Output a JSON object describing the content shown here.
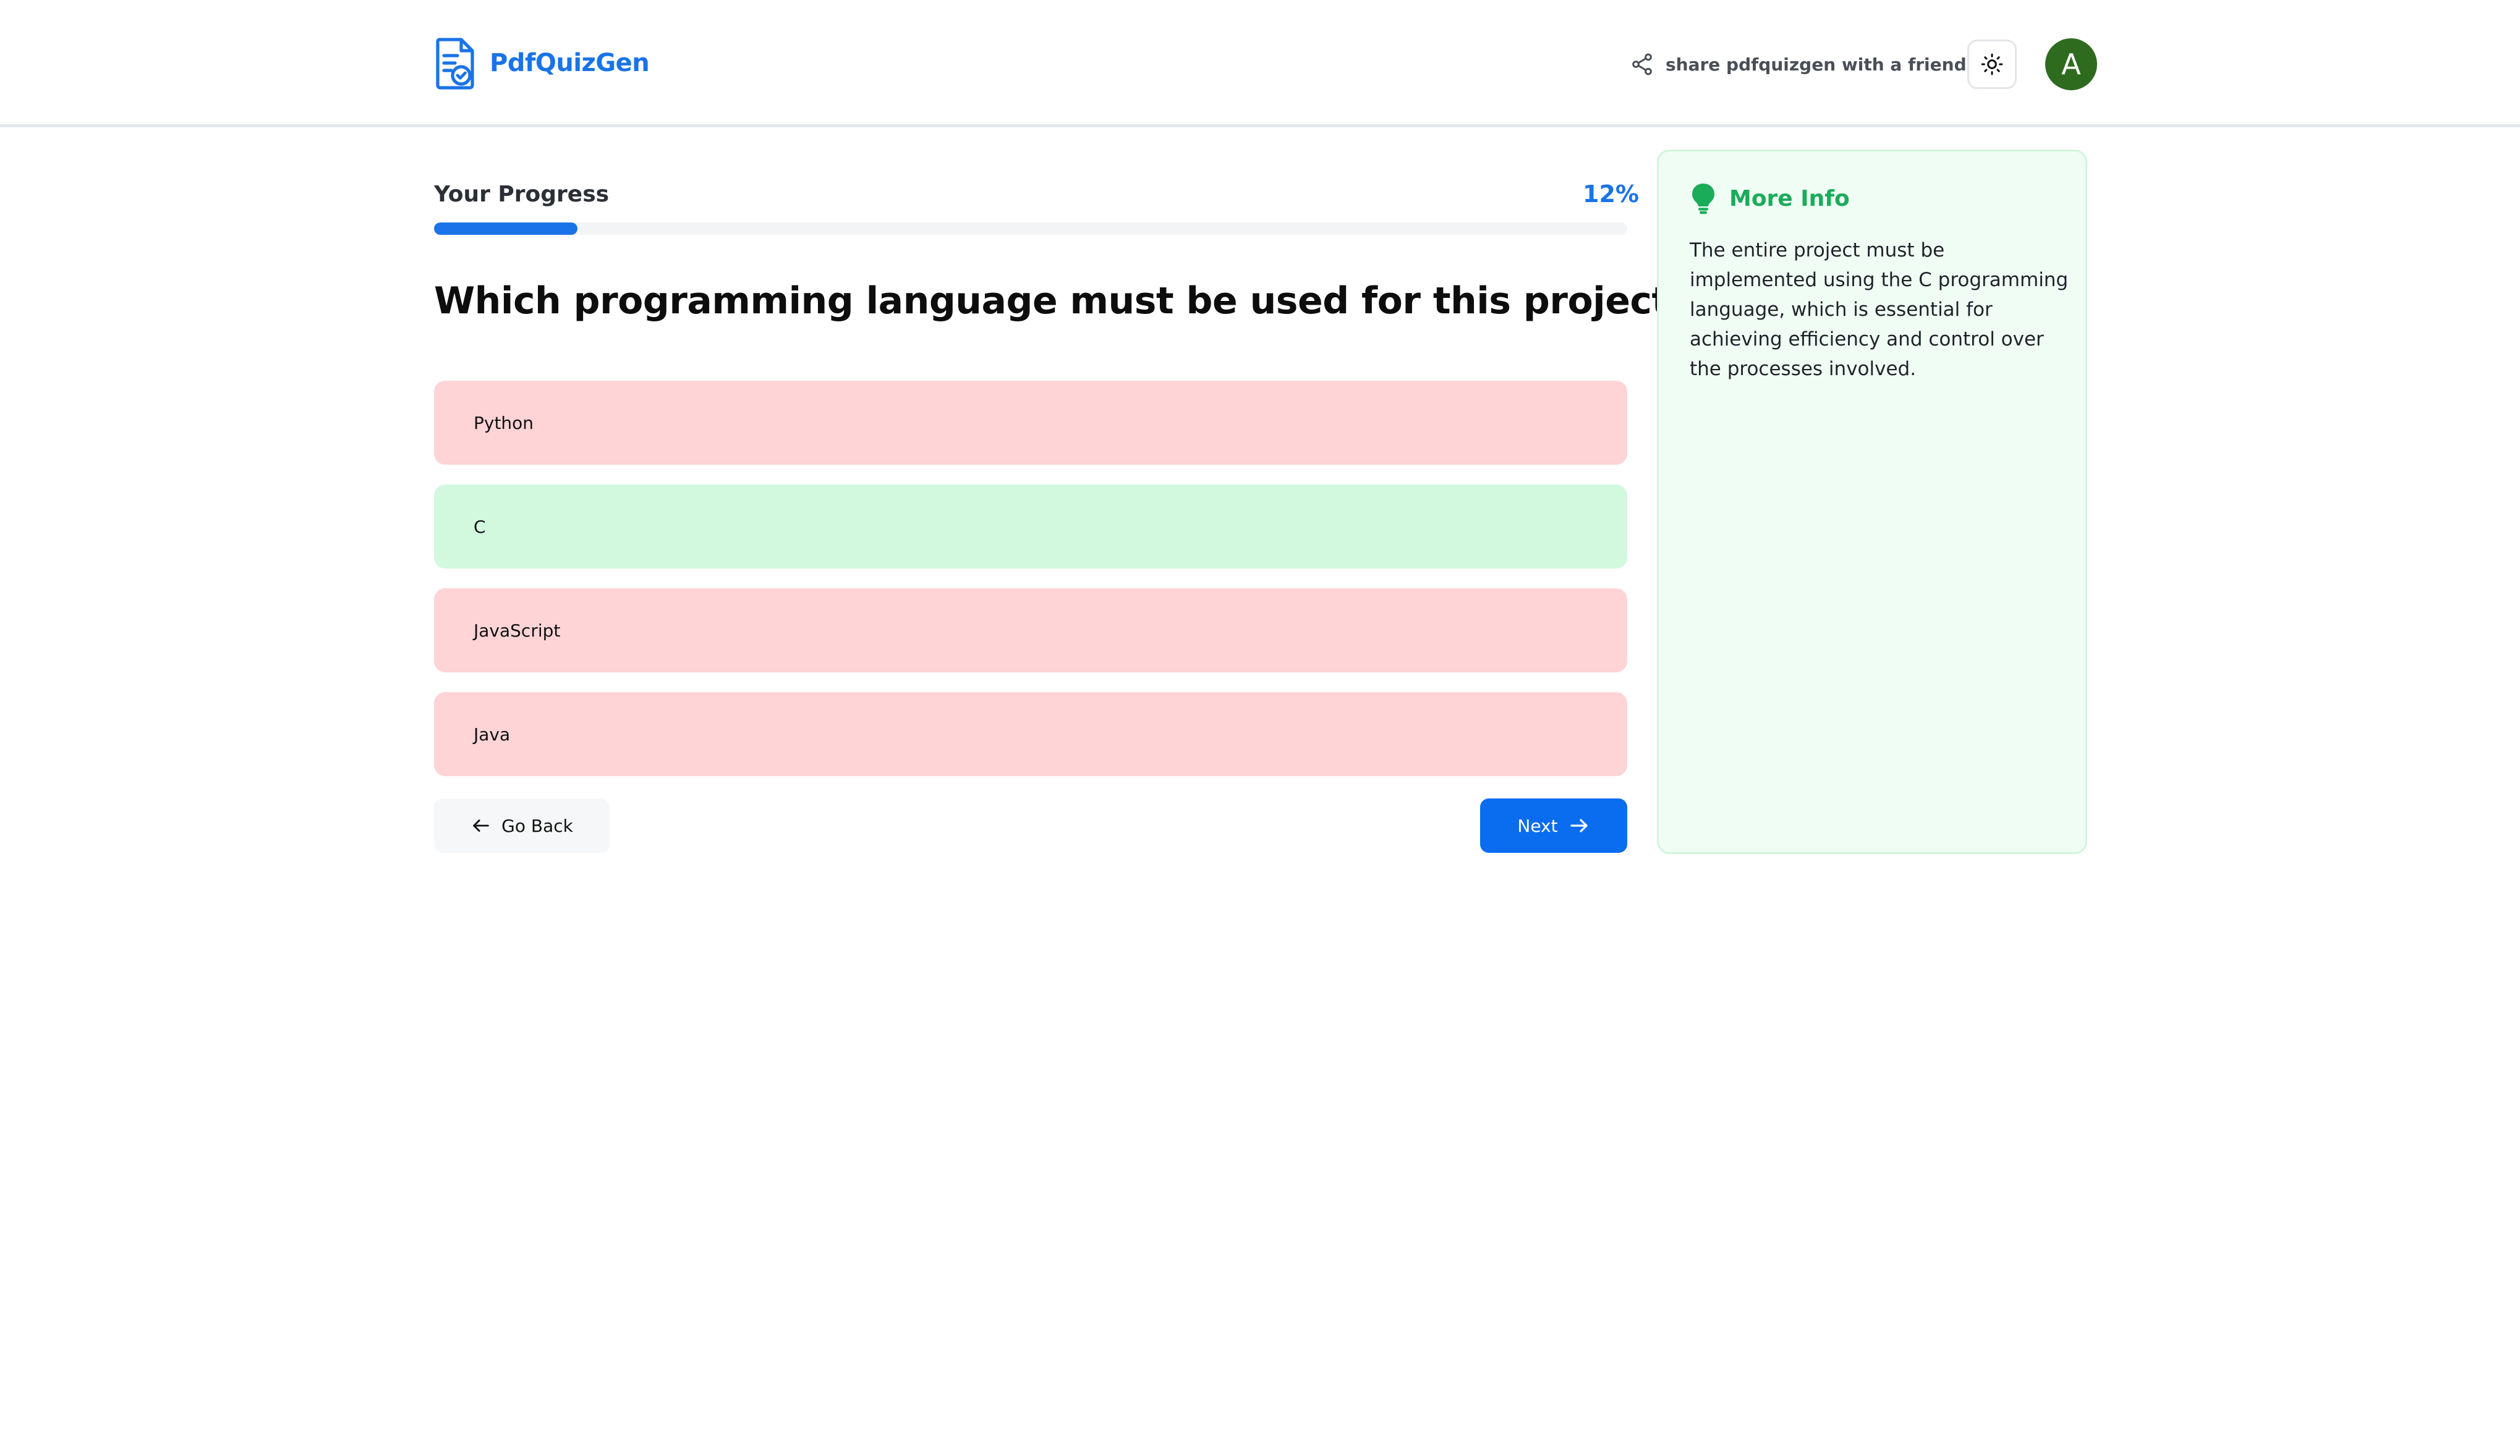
{
  "header": {
    "logo_text": "PdfQuizGen",
    "share_text": "share pdfquizgen with a friend",
    "avatar_initial": "A",
    "brand_color": "#1a73e8",
    "avatar_color": "#2e6b1f",
    "icons": {
      "logo": "document-check-icon",
      "share": "share-icon",
      "theme": "sun-icon"
    }
  },
  "progress": {
    "label": "Your Progress",
    "percent_text": "12%",
    "value_percent": 12
  },
  "question": {
    "text": "Which programming language must be used for this project?"
  },
  "options": [
    {
      "label": "Python",
      "state": "wrong"
    },
    {
      "label": "C",
      "state": "correct"
    },
    {
      "label": "JavaScript",
      "state": "wrong"
    },
    {
      "label": "Java",
      "state": "wrong"
    }
  ],
  "nav": {
    "back_label": "Go Back",
    "next_label": "Next",
    "next_color": "#0a6df0"
  },
  "info": {
    "title": "More Info",
    "text": "The entire project must be implemented using the C programming language, which is essential for achieving efficiency and control over the processes involved.",
    "accent_color": "#1bac5a",
    "icon": "lightbulb-icon"
  },
  "colors": {
    "wrong_option": "#fed4d6",
    "correct_option": "#d2f8de",
    "info_background": "#f0fdf4"
  }
}
